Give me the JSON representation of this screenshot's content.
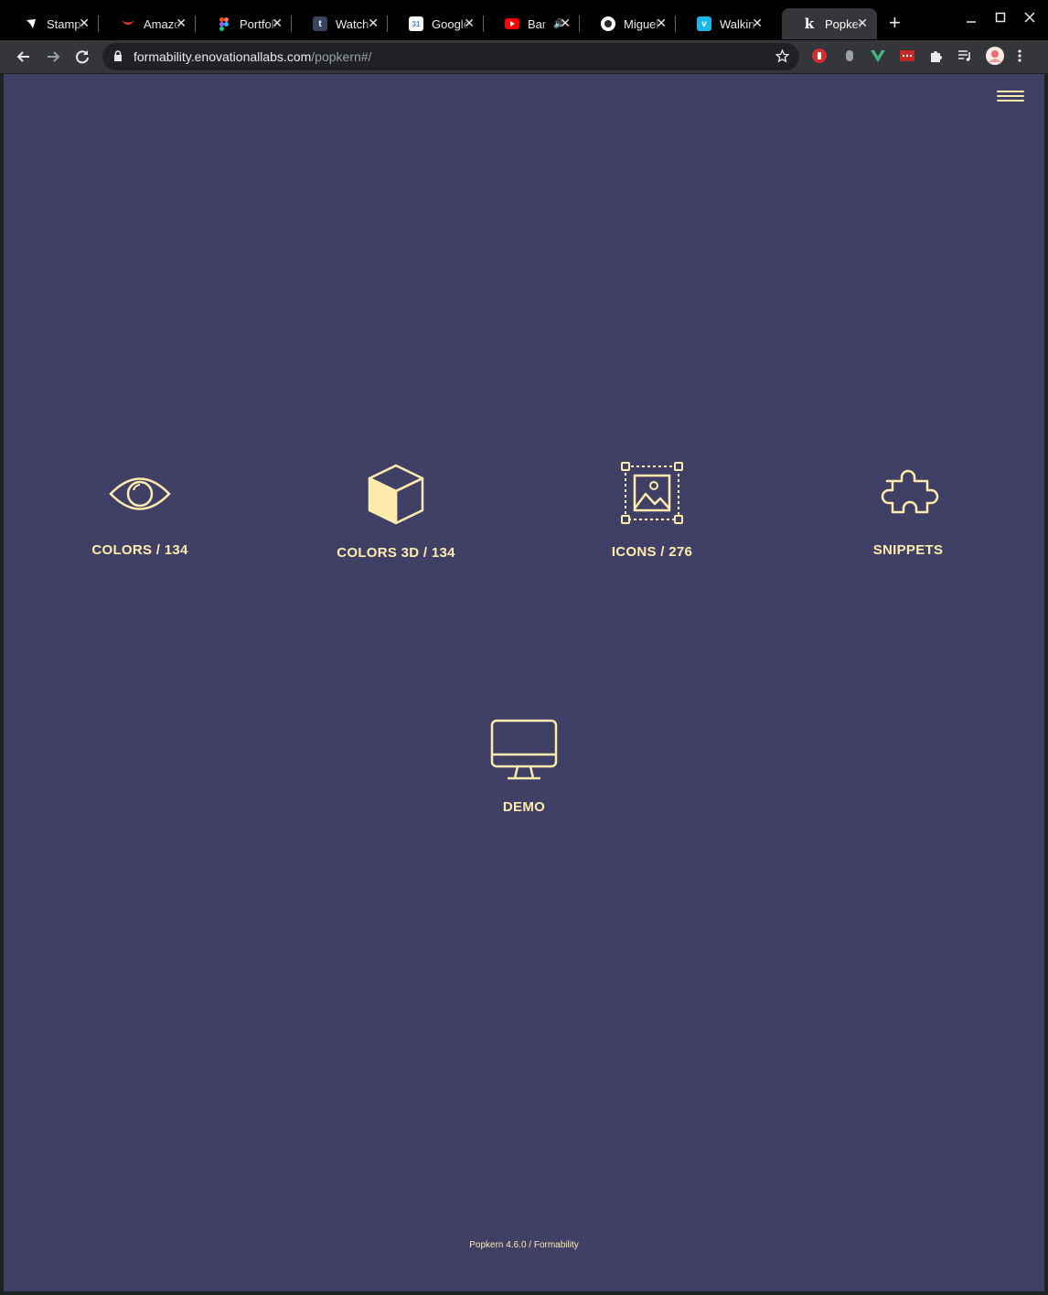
{
  "browser": {
    "tabs": [
      {
        "title": "Stamps",
        "icon": "stamps-favicon",
        "color": "#ffffff"
      },
      {
        "title": "Amazon",
        "icon": "amazon-favicon",
        "color": "#e53935"
      },
      {
        "title": "Portfolio",
        "icon": "figma-favicon",
        "color": "#a259ff"
      },
      {
        "title": "Watch",
        "icon": "tumblr-favicon",
        "color": "#35465c"
      },
      {
        "title": "Google",
        "icon": "google-calendar-favicon",
        "color": "#4285f4"
      },
      {
        "title": "Bar",
        "icon": "youtube-favicon",
        "color": "#ff0000"
      },
      {
        "title": "Miguel",
        "icon": "github-favicon",
        "color": "#ffffff"
      },
      {
        "title": "Walkin",
        "icon": "vimeo-favicon",
        "color": "#1ab7ea"
      },
      {
        "title": "Popkern",
        "icon": "k-favicon",
        "color": "#ffffff"
      }
    ],
    "active_tab_index": 8,
    "url_host": "formability.enovationallabs.com",
    "url_path": "/popkern#/"
  },
  "menu": {
    "icon": "hamburger-menu-icon"
  },
  "cards": [
    {
      "label": "COLORS / 134",
      "icon": "eye-icon"
    },
    {
      "label": "COLORS 3D / 134",
      "icon": "cube-icon"
    },
    {
      "label": "ICONS / 276",
      "icon": "image-frame-icon"
    },
    {
      "label": "SNIPPETS",
      "icon": "puzzle-icon"
    },
    {
      "label": "DEMO",
      "icon": "monitor-icon"
    }
  ],
  "footer": "Popkern 4.6.0 / Formability",
  "colors": {
    "page_background": "#403f66",
    "accent": "#ffecad"
  }
}
